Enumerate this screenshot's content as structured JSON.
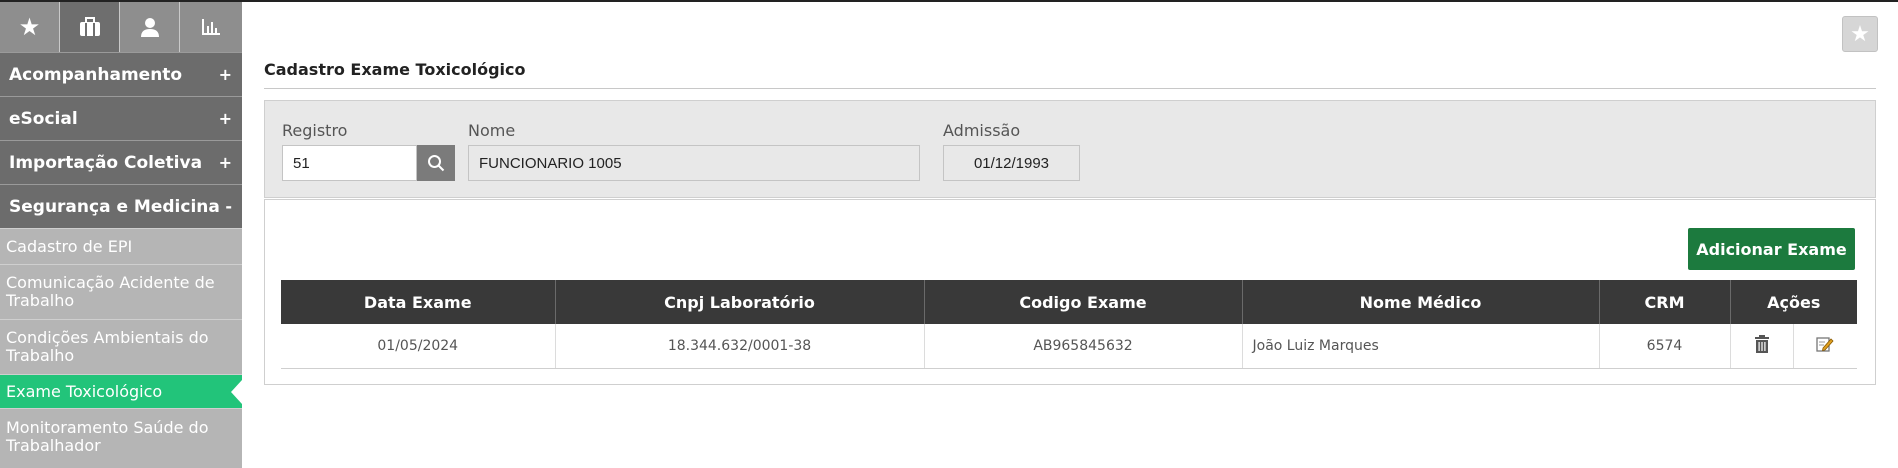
{
  "sidebar": {
    "tabs": [
      {
        "icon": "star-icon",
        "glyph": "★"
      },
      {
        "icon": "briefcase-icon"
      },
      {
        "icon": "user-icon"
      },
      {
        "icon": "bar-chart-icon"
      }
    ],
    "sections": [
      {
        "label": "Acompanhamento",
        "sign": "+"
      },
      {
        "label": "eSocial",
        "sign": "+"
      },
      {
        "label": "Importação Coletiva",
        "sign": "+"
      },
      {
        "label": "Segurança e Medicina",
        "sign": "-"
      }
    ],
    "items": [
      {
        "label": "Cadastro de EPI"
      },
      {
        "label": "Comunicação Acidente de Trabalho"
      },
      {
        "label": "Condições Ambientais do Trabalho"
      },
      {
        "label": "Exame Toxicológico",
        "active": true
      },
      {
        "label": "Monitoramento Saúde do Trabalhador"
      }
    ]
  },
  "header": {
    "favorite_glyph": "★"
  },
  "page": {
    "title": "Cadastro Exame Toxicológico"
  },
  "form": {
    "registro_label": "Registro",
    "registro_value": "51",
    "nome_label": "Nome",
    "nome_value": "FUNCIONARIO 1005",
    "admissao_label": "Admissão",
    "admissao_value": "01/12/1993"
  },
  "actions": {
    "add_label": "Adicionar Exame"
  },
  "table": {
    "columns": [
      "Data Exame",
      "Cnpj Laboratório",
      "Codigo Exame",
      "Nome Médico",
      "CRM",
      "Ações"
    ],
    "rows": [
      {
        "data_exame": "01/05/2024",
        "cnpj": "18.344.632/0001-38",
        "codigo": "AB965845632",
        "medico": "João Luiz Marques",
        "crm": "6574"
      }
    ]
  },
  "colors": {
    "accent_green": "#22c47a",
    "button_green": "#1c7a3e",
    "header_dark": "#393939",
    "menu_dark": "#6c6c6c"
  }
}
